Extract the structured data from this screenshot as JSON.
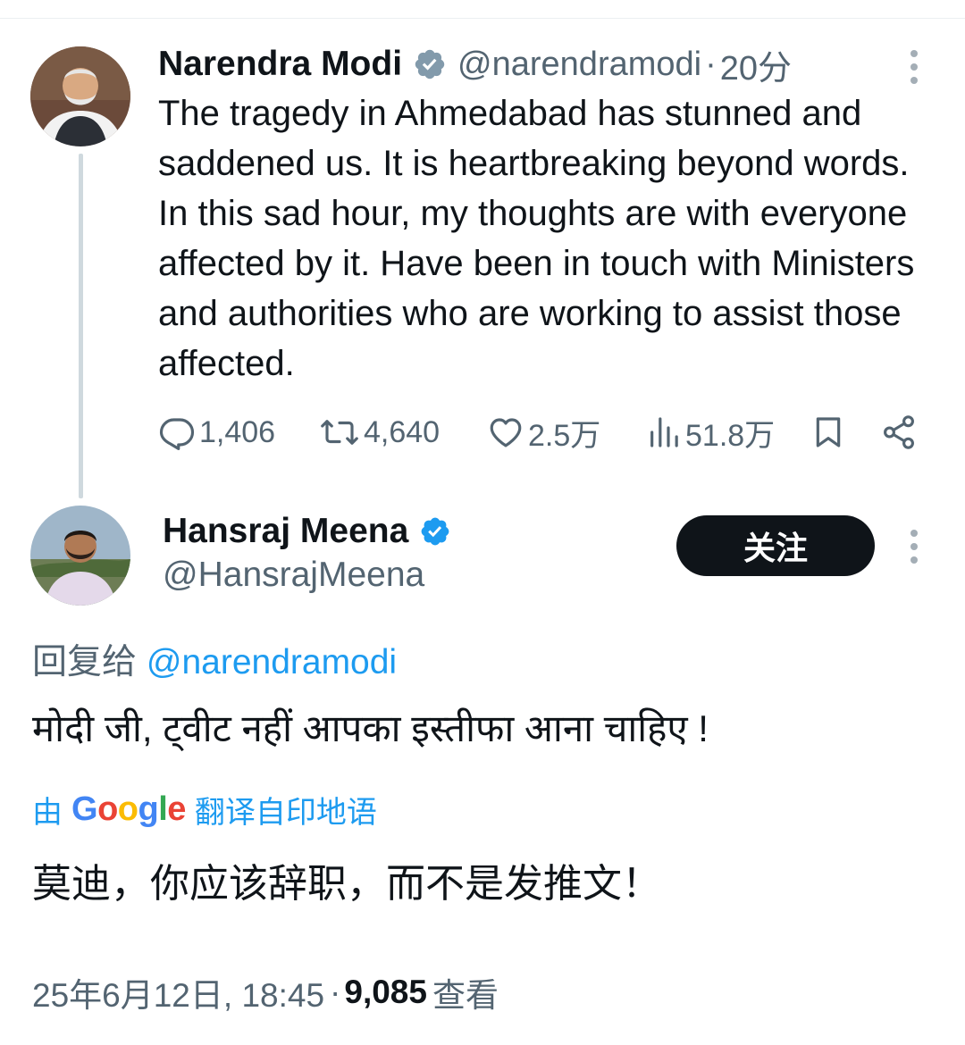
{
  "parent_tweet": {
    "author_name": "Narendra Modi",
    "handle": "@narendramodi",
    "separator": "·",
    "time": "20分",
    "text": "The tragedy in Ahmedabad has stunned and saddened us. It is heartbreaking beyond words. In this sad hour, my thoughts are with everyone affected by it. Have been in touch with Ministers and authorities who are working to assist those affected.",
    "avatar_icon": "person-avatar",
    "verified_icon": "verified-badge-gray",
    "more_icon": "more-vertical-icon",
    "actions": {
      "replies": "1,406",
      "reposts": "4,640",
      "likes": "2.5万",
      "views": "51.8万"
    }
  },
  "reply_tweet": {
    "author_name": "Hansraj Meena",
    "handle": "@HansrajMeena",
    "follow_label": "关注",
    "verified_icon": "verified-badge-blue",
    "reply_to_prefix": "回复给",
    "reply_to_handle": "@narendramodi",
    "text": "मोदी जी, ट्वीट नहीं आपका इस्तीफा आना चाहिए !",
    "translate_prefix": "由",
    "translate_brand": "Google",
    "translate_suffix": "翻译自印地语",
    "translated_text": "莫迪，你应该辞职，而不是发推文！",
    "timestamp": "25年6月12日, 18:45",
    "meta_separator": "·",
    "views_count": "9,085",
    "views_label": "查看"
  },
  "colors": {
    "text_primary": "#0f1419",
    "text_secondary": "#536471",
    "accent_blue": "#1d9bf0",
    "thread_line": "#cfd9de",
    "button_dark": "#0f1419"
  }
}
